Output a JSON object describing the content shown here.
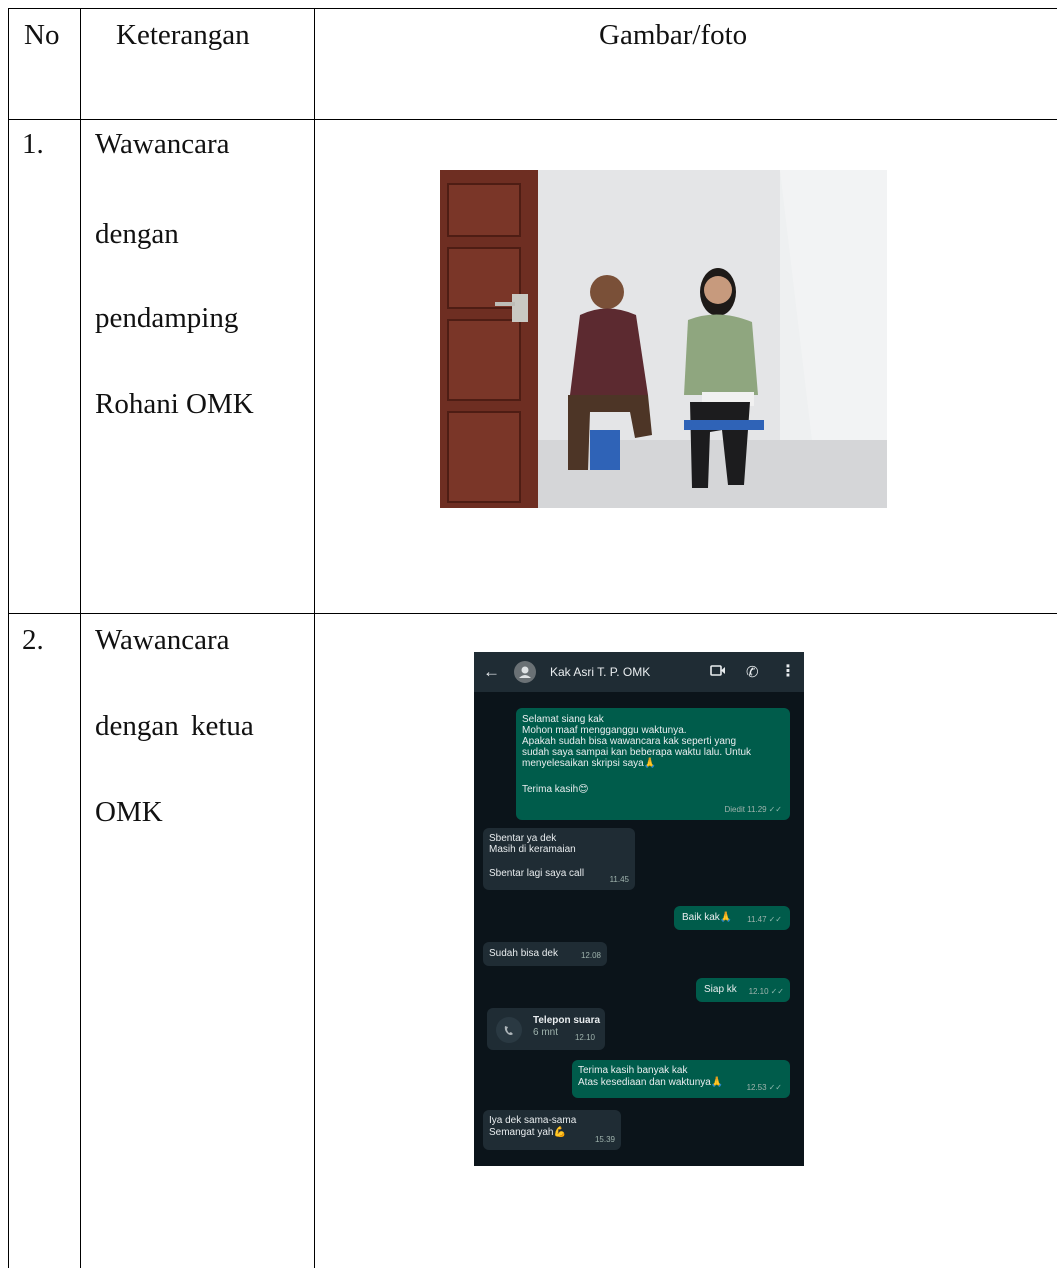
{
  "table": {
    "headers": {
      "no": "No",
      "description": "Keterangan",
      "image": "Gambar/foto"
    },
    "rows": [
      {
        "no": "1.",
        "description_lines": [
          "Wawancara",
          "dengan",
          "pendamping",
          "Rohani OMK"
        ]
      },
      {
        "no": "2.",
        "description_lines": [
          "Wawancara",
          "dengan  ketua",
          "OMK"
        ]
      }
    ]
  },
  "chat": {
    "contact_name": "Kak Asri T. P. OMK",
    "icons": {
      "back": "back-arrow-icon",
      "avatar": "person-icon",
      "video": "video-call-icon",
      "call": "phone-icon",
      "more": "more-vert-icon"
    },
    "messages": [
      {
        "direction": "out",
        "lines": [
          "Selamat siang kak",
          "Mohon maaf mengganggu waktunya.",
          "Apakah sudah bisa wawancara kak seperti yang",
          "sudah saya sampai kan beberapa waktu lalu. Untuk",
          "menyelesaikan skripsi saya🙏",
          "",
          "Terima kasih😊"
        ],
        "time": "Diedit 11.29"
      },
      {
        "direction": "in",
        "lines": [
          "Sbentar ya dek",
          "Masih di keramaian",
          "",
          "Sbentar lagi saya call"
        ],
        "time": "11.45"
      },
      {
        "direction": "out",
        "lines": [
          "Baik kak🙏"
        ],
        "time": "11.47"
      },
      {
        "direction": "in",
        "lines": [
          "Sudah bisa dek"
        ],
        "time": "12.08"
      },
      {
        "direction": "out",
        "lines": [
          "Siap kk"
        ],
        "time": "12.10"
      },
      {
        "direction": "in",
        "call_title": "Telepon suara",
        "call_duration": "6 mnt",
        "time": "12.10"
      },
      {
        "direction": "out",
        "lines": [
          "Terima kasih banyak kak",
          "Atas kesediaan dan waktunya🙏"
        ],
        "time": "12.53"
      },
      {
        "direction": "in",
        "lines": [
          "Iya dek sama-sama",
          "Semangat yah💪"
        ],
        "time": "15.39"
      }
    ],
    "colors": {
      "background": "#0b141a",
      "header": "#1f2c34",
      "outgoing": "#005c4b",
      "incoming": "#1f2c34"
    }
  }
}
